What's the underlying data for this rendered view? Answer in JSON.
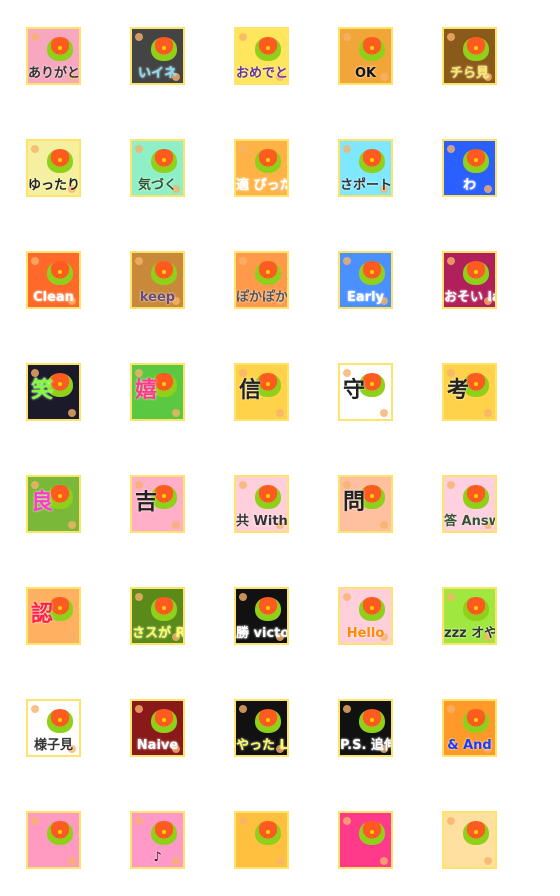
{
  "stickers": [
    {
      "text": "ありがと",
      "bg": "#f7a8c0",
      "fg": "#333333",
      "big": false
    },
    {
      "text": "いイネ",
      "bg": "#444444",
      "fg": "#7fe0ff",
      "big": false
    },
    {
      "text": "おめでと",
      "bg": "#ffe65c",
      "fg": "#663399",
      "big": false
    },
    {
      "text": "OK",
      "bg": "#f2a63a",
      "fg": "#111111",
      "big": false
    },
    {
      "text": "チら見",
      "bg": "#8a5a1a",
      "fg": "#ffe85c",
      "big": false
    },
    {
      "text": "ゆったり",
      "bg": "#f4f0a0",
      "fg": "#222222",
      "big": false
    },
    {
      "text": "気づく",
      "bg": "#8ff0c8",
      "fg": "#335533",
      "big": false
    },
    {
      "text": "適 ぴったり",
      "bg": "#ffb347",
      "fg": "#ffffff",
      "big": false
    },
    {
      "text": "さポート",
      "bg": "#7fe8ff",
      "fg": "#333333",
      "big": false
    },
    {
      "text": "わ",
      "bg": "#2a60ff",
      "fg": "#ffffff",
      "big": false
    },
    {
      "text": "Clean",
      "bg": "#ff6a2a",
      "fg": "#ffffff",
      "big": false
    },
    {
      "text": "keep",
      "bg": "#c88a3a",
      "fg": "#6a4a7a",
      "big": false
    },
    {
      "text": "ぽかぽか Warm",
      "bg": "#ff9a4a",
      "fg": "#555555",
      "big": false
    },
    {
      "text": "Early",
      "bg": "#4a90ff",
      "fg": "#ffffff",
      "big": false
    },
    {
      "text": "おそい late",
      "bg": "#b0205a",
      "fg": "#ffffff",
      "big": false
    },
    {
      "text": "笑",
      "bg": "#1a1a2a",
      "fg": "#7fff3a",
      "big": true
    },
    {
      "text": "嬉",
      "bg": "#5ac840",
      "fg": "#ff3a8a",
      "big": true
    },
    {
      "text": "信",
      "bg": "#ffd24a",
      "fg": "#222222",
      "big": true
    },
    {
      "text": "守",
      "bg": "#ffffff",
      "fg": "#222222",
      "big": true
    },
    {
      "text": "考",
      "bg": "#ffd24a",
      "fg": "#222222",
      "big": true
    },
    {
      "text": "良",
      "bg": "#7ab83a",
      "fg": "#ff3ac8",
      "big": true
    },
    {
      "text": "吉",
      "bg": "#ffb0c8",
      "fg": "#222222",
      "big": true
    },
    {
      "text": "共 With",
      "bg": "#ffd0dc",
      "fg": "#333333",
      "big": false
    },
    {
      "text": "問",
      "bg": "#ffc0a0",
      "fg": "#222222",
      "big": true
    },
    {
      "text": "答 Answer",
      "bg": "#ffd0e0",
      "fg": "#335533",
      "big": false
    },
    {
      "text": "認",
      "bg": "#ffb060",
      "fg": "#ff2050",
      "big": true
    },
    {
      "text": "さスが Respect",
      "bg": "#5a8a1a",
      "fg": "#ffff5a",
      "big": false
    },
    {
      "text": "勝 victory",
      "bg": "#111111",
      "fg": "#ffffff",
      "big": false
    },
    {
      "text": "Hello",
      "bg": "#ffd0dc",
      "fg": "#ff8a00",
      "big": false
    },
    {
      "text": "zzz オやスみ",
      "bg": "#a0e840",
      "fg": "#333333",
      "big": false
    },
    {
      "text": "様子見",
      "bg": "#ffffff",
      "fg": "#333333",
      "big": false
    },
    {
      "text": "Naive",
      "bg": "#8a1a1a",
      "fg": "#ffffff",
      "big": false
    },
    {
      "text": "やった Lucky",
      "bg": "#111111",
      "fg": "#ffff5a",
      "big": false
    },
    {
      "text": "P.S. 追伸",
      "bg": "#111111",
      "fg": "#ffffff",
      "big": false
    },
    {
      "text": "& And",
      "bg": "#ff9a2a",
      "fg": "#1a3aff",
      "big": false
    },
    {
      "text": "",
      "bg": "#ff9ac0",
      "fg": "#ffffff",
      "big": false
    },
    {
      "text": "♪",
      "bg": "#ff9ac8",
      "fg": "#222222",
      "big": false
    },
    {
      "text": "",
      "bg": "#ffc040",
      "fg": "#ffffff",
      "big": false
    },
    {
      "text": "",
      "bg": "#ff3a8a",
      "fg": "#ffffff",
      "big": false
    },
    {
      "text": "",
      "bg": "#ffe0a0",
      "fg": "#ffffff",
      "big": false
    }
  ]
}
